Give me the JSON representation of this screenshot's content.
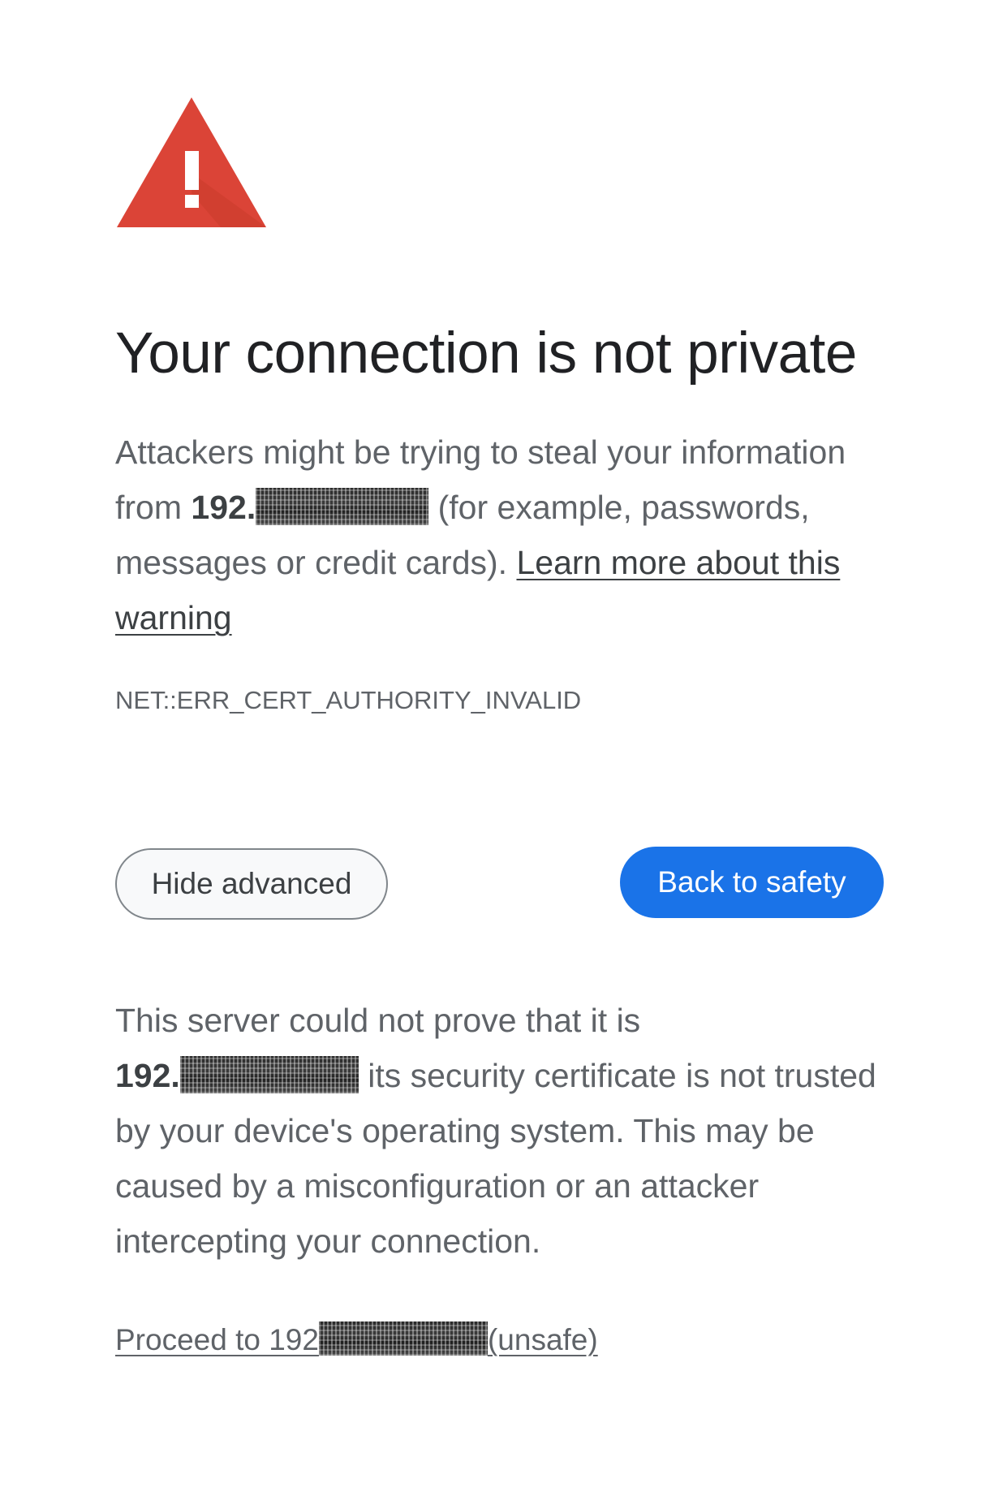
{
  "icon": {
    "name": "warning-triangle-icon",
    "color": "#d93025"
  },
  "title": "Your connection is not private",
  "warning": {
    "text_before_host": "Attackers might be trying to steal your information from",
    "host": "192.",
    "text_after_host": "(for example, passwords, messages or credit cards).",
    "learn_more_link": "Learn more about this warning"
  },
  "error_code": "NET::ERR_CERT_AUTHORITY_INVALID",
  "buttons": {
    "hide_advanced": "Hide advanced",
    "back_to_safety": "Back to safety"
  },
  "advanced": {
    "text_before_host": "This server could not prove that it is",
    "host": "192.",
    "text_after_host": "its security certificate is not trusted by your device's operating system. This may be caused by a misconfiguration or an attacker intercepting your connection."
  },
  "proceed": {
    "prefix": "Proceed to 192",
    "suffix": "(unsafe)"
  },
  "colors": {
    "accent": "#1a73e8",
    "error": "#d93025",
    "text_primary": "#202124",
    "text_secondary": "#5f6368"
  }
}
